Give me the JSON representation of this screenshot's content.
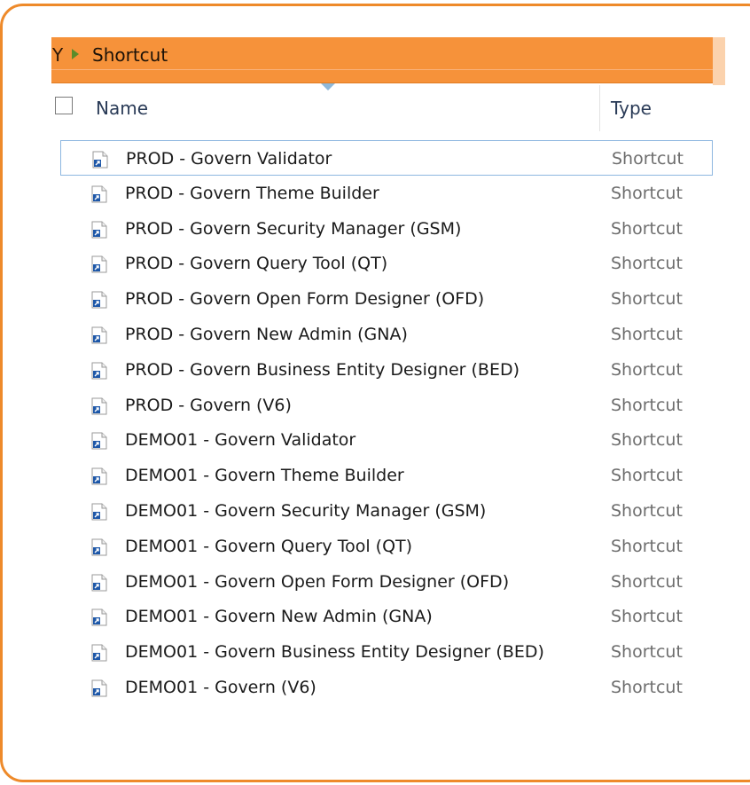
{
  "breadcrumb": {
    "previous": "Y",
    "current": "Shortcut"
  },
  "columns": {
    "name": "Name",
    "type": "Type"
  },
  "icon": "shortcut-file-icon",
  "colors": {
    "frame_border": "#ee8a2a",
    "breadcrumb_bg": "#f6923a",
    "focus_border": "#8db7e0",
    "type_text": "#6d6d6d"
  },
  "rows": [
    {
      "name": "PROD - Govern Validator",
      "type": "Shortcut"
    },
    {
      "name": "PROD - Govern Theme Builder",
      "type": "Shortcut"
    },
    {
      "name": "PROD - Govern Security Manager (GSM)",
      "type": "Shortcut"
    },
    {
      "name": "PROD - Govern Query Tool (QT)",
      "type": "Shortcut"
    },
    {
      "name": "PROD - Govern Open Form Designer (OFD)",
      "type": "Shortcut"
    },
    {
      "name": "PROD - Govern New Admin (GNA)",
      "type": "Shortcut"
    },
    {
      "name": "PROD - Govern Business Entity Designer (BED)",
      "type": "Shortcut"
    },
    {
      "name": "PROD - Govern (V6)",
      "type": "Shortcut"
    },
    {
      "name": "DEMO01 - Govern Validator",
      "type": "Shortcut"
    },
    {
      "name": "DEMO01 - Govern Theme Builder",
      "type": "Shortcut"
    },
    {
      "name": "DEMO01 - Govern Security Manager (GSM)",
      "type": "Shortcut"
    },
    {
      "name": "DEMO01 - Govern Query Tool (QT)",
      "type": "Shortcut"
    },
    {
      "name": "DEMO01 - Govern Open Form Designer (OFD)",
      "type": "Shortcut"
    },
    {
      "name": "DEMO01 - Govern New Admin (GNA)",
      "type": "Shortcut"
    },
    {
      "name": "DEMO01 - Govern Business Entity Designer (BED)",
      "type": "Shortcut"
    },
    {
      "name": "DEMO01 - Govern (V6)",
      "type": "Shortcut"
    }
  ]
}
